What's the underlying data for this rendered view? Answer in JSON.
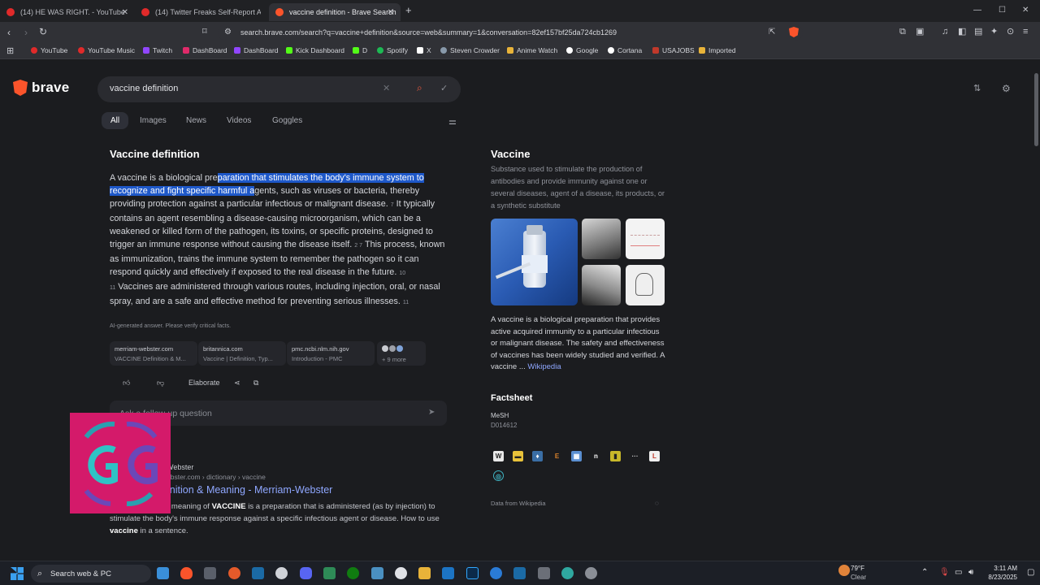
{
  "tabs": [
    {
      "label": "(14) HE WAS RIGHT. - YouTube",
      "color": "#e02a2a"
    },
    {
      "label": "(14) Twitter Freaks Self-Report After I",
      "color": "#e02a2a"
    },
    {
      "label": "vaccine definition - Brave Search",
      "color": "#fb542b"
    }
  ],
  "window": {
    "minimize": "—",
    "maximize": "☐",
    "close": "✕"
  },
  "url": "search.brave.com/search?q=vaccine+definition&source=web&summary=1&conversation=82ef157bf25da724cb1269",
  "bookmarks": [
    {
      "label": "YouTube",
      "color": "#e02a2a"
    },
    {
      "label": "YouTube Music",
      "color": "#e02a2a"
    },
    {
      "label": "Twitch",
      "color": "#9146ff"
    },
    {
      "label": "DashBoard",
      "color": "#e02a6a"
    },
    {
      "label": "DashBoard",
      "color": "#9146ff"
    },
    {
      "label": "Kick Dashboard",
      "color": "#53fc18"
    },
    {
      "label": "D",
      "color": "#53fc18"
    },
    {
      "label": "Spotify",
      "color": "#1db954"
    },
    {
      "label": "X",
      "color": "#ffffff"
    },
    {
      "label": "Steven Crowder",
      "color": "#8899aa"
    },
    {
      "label": "Anime Watch",
      "color": "#e8b339"
    },
    {
      "label": "Google",
      "color": "#ffffff"
    },
    {
      "label": "Cortana",
      "color": "#ffffff"
    },
    {
      "label": "USAJOBS",
      "color": "#c0392b"
    },
    {
      "label": "Imported",
      "color": "#e8b339"
    }
  ],
  "search": {
    "logo": "brave",
    "query": "vaccine definition"
  },
  "nav_tabs": [
    "All",
    "Images",
    "News",
    "Videos",
    "Goggles"
  ],
  "answer": {
    "title": "Vaccine definition",
    "p_pre": "A vaccine is a biological pre",
    "p_hl": "paration that stimulates the body's immune system to recognize and fight specific harmful a",
    "p_mid1": "gents, such as viruses or bacteria, thereby providing protection against a particular infectious or malignant disease.",
    "cite1": "7",
    "p_mid2": "It typically contains an agent resembling a disease-causing microorganism, which can be a weakened or killed form of the pathogen, its toxins, or specific proteins, designed to trigger an immune response without causing the disease itself.",
    "cite2": "2  7",
    "p_mid3": "This process, known as immunization, trains the immune system to remember the pathogen so it can respond quickly and effectively if exposed to the real disease in the future.",
    "cite3": "10  11",
    "p_mid4": "Vaccines are administered through various routes, including injection, oral, or nasal spray, and are a safe and effective method for preventing serious illnesses.",
    "cite4": "11",
    "disclaimer": "AI-generated answer. Please verify critical facts."
  },
  "sources": [
    {
      "domain": "merriam-webster.com",
      "title": "VACCINE Definition & M..."
    },
    {
      "domain": "britannica.com",
      "title": "Vaccine | Definition, Typ..."
    },
    {
      "domain": "pmc.ncbi.nlm.nih.gov",
      "title": "Introduction - PMC"
    },
    {
      "domain": "",
      "title": "+ 9 more"
    }
  ],
  "actions": {
    "elaborate": "Elaborate"
  },
  "followup_placeholder": "Ask a follow-up question",
  "result": {
    "site": "Webster",
    "url": "ebster.com › dictionary › vaccine",
    "title": "inition & Meaning - Merriam-Webster",
    "desc_pre": "e meaning of ",
    "desc_b1": "VACCINE",
    "desc_mid": " is a preparation that is administered (as by injection) to stimulate the body's immune response against a specific infectious agent or disease. How to use ",
    "desc_b2": "vaccine",
    "desc_post": " in a sentence."
  },
  "panel": {
    "title": "Vaccine",
    "subtitle": "Substance used to stimulate the production of antibodies and provide immunity against one or several diseases, agent of a disease, its products, or a synthetic substitute",
    "desc": "A vaccine is a biological preparation that provides active acquired immunity to a particular infectious or malignant disease. The safety and effectiveness of vaccines has been widely studied and verified. A vaccine ...",
    "wiki_link": "Wikipedia",
    "factsheet_title": "Factsheet",
    "fact_key": "MeSH",
    "fact_val": "D014612",
    "data_from": "Data from Wikipedia"
  },
  "taskbar": {
    "search": "Search web & PC",
    "weather_temp": "79°F",
    "weather_desc": "Clear",
    "time": "3:11 AM",
    "date": "8/23/2025"
  }
}
